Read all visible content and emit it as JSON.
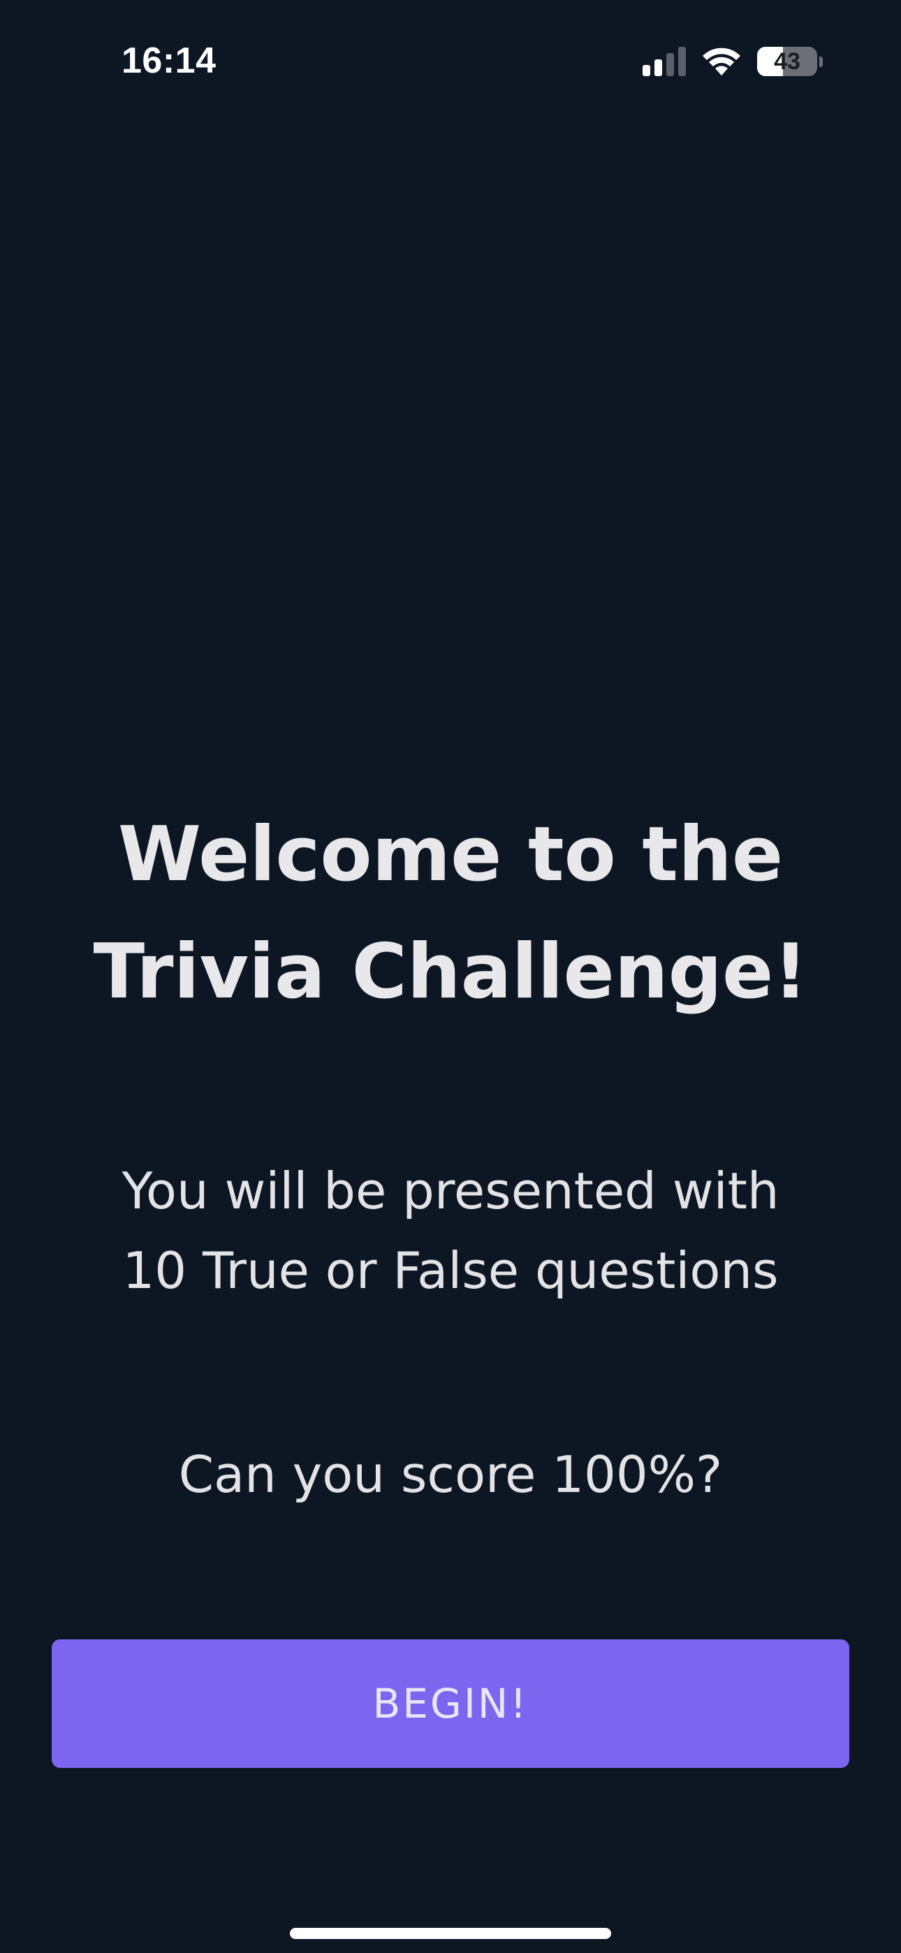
{
  "status_bar": {
    "time": "16:14",
    "signal_bars_active": 2,
    "signal_bars_total": 4,
    "signal_icon": "cellular-signal-icon",
    "wifi_icon": "wifi-icon",
    "battery_icon": "battery-icon",
    "battery_level": "43",
    "battery_fraction": 0.43
  },
  "welcome": {
    "title_lines": [
      "Welcome to the",
      "Trivia Challenge!"
    ],
    "intro_lines": [
      "You will be presented with",
      "10 True or False questions"
    ],
    "challenge": "Can you score 100%?"
  },
  "actions": {
    "begin_label": "BEGIN!"
  },
  "colors": {
    "background": "#0d1623",
    "accent": "#7c66f0",
    "text": "#e8e8ea"
  }
}
